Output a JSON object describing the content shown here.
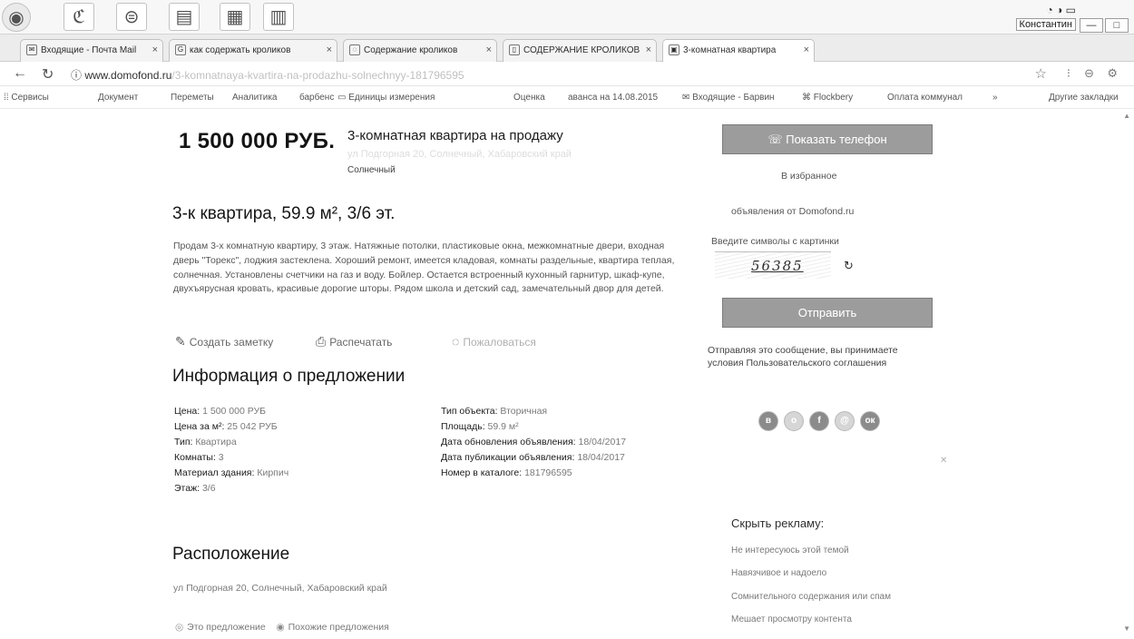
{
  "browser": {
    "tabs": [
      {
        "label": "Входящие - Почта Mail",
        "icon": "mail-icon"
      },
      {
        "label": "как содержать кроликов",
        "icon": "google-icon"
      },
      {
        "label": "Содержание кроликов",
        "icon": "page-icon"
      },
      {
        "label": "СОДЕРЖАНИЕ КРОЛИКОВ",
        "icon": "doc-icon"
      },
      {
        "label": "3-комнатная квартира",
        "icon": "domofond-icon"
      }
    ],
    "url_host": "www.domofond.ru",
    "url_path": "/3-komnatnaya-kvartira-na-prodazhu-solnechnyy-181796595",
    "user_name": "Константин",
    "bookmarks": [
      "Сервисы",
      "Документ",
      "Переметы",
      "Аналитика",
      "барбенс",
      "Единицы измерения",
      "Оценка",
      "аванса на 14.08.2015",
      "Входящие - Барвин",
      "Flockbery",
      "Оплата коммунал",
      "»",
      "Другие закладки"
    ]
  },
  "listing": {
    "price": "1 500 000 РУБ.",
    "title": "3-комнатная квартира на продажу",
    "address_line": "ул Подгорная 20, Солнечный, Хабаровский край",
    "city": "Солнечный",
    "heading": "3-к квартира, 59.9 м², 3/6 эт.",
    "description": "Продам 3-х комнатную квартиру, 3 этаж. Натяжные потолки, пластиковые окна, межкомнатные двери, входная дверь \"Торекс\", лоджия застеклена. Хороший ремонт, имеется кладовая, комнаты раздельные, квартира теплая, солнечная. Установлены счетчики на газ и воду. Бойлер. Остается встроенный кухонный гарнитур, шкаф-купе, двухъярусная кровать, красивые дорогие шторы. Рядом школа и детский сад, замечательный двор для детей.",
    "actions": {
      "note": "Создать заметку",
      "print": "Распечатать",
      "complain": "Пожаловаться"
    }
  },
  "info": {
    "heading": "Информация о предложении",
    "left": [
      {
        "k": "Цена:",
        "v": "1 500 000 РУБ"
      },
      {
        "k": "Цена за м²:",
        "v": "25 042 РУБ"
      },
      {
        "k": "Тип:",
        "v": "Квартира"
      },
      {
        "k": "Комнаты:",
        "v": "3"
      },
      {
        "k": "Материал здания:",
        "v": "Кирпич"
      },
      {
        "k": "Этаж:",
        "v": "3/6"
      }
    ],
    "right": [
      {
        "k": "Тип объекта:",
        "v": "Вторичная"
      },
      {
        "k": "Площадь:",
        "v": "59.9 м²"
      },
      {
        "k": "Дата обновления объявления:",
        "v": "18/04/2017"
      },
      {
        "k": "Дата публикации объявления:",
        "v": "18/04/2017"
      },
      {
        "k": "Номер в каталоге:",
        "v": "181796595"
      }
    ]
  },
  "location": {
    "heading": "Расположение",
    "address": "ул Подгорная 20, Солнечный, Хабаровский край",
    "link_this": "Это предложение",
    "link_similar": "Похожие предложения"
  },
  "sidebar": {
    "show_phone": "Показать телефон",
    "favorite": "В избранное",
    "notify": "объявления от Domofond.ru",
    "captcha_label": "Введите символы с картинки",
    "captcha_text": "56385",
    "send": "Отправить",
    "agree": "Отправляя это сообщение, вы принимаете условия Пользовательского соглашения",
    "social": [
      "vk-icon",
      "ok-icon",
      "facebook-icon",
      "mail-icon",
      "odnoklassniki-icon"
    ],
    "hide_ads_title": "Скрыть рекламу:",
    "hide_reasons": [
      "Не интересуюсь этой темой",
      "Навязчивое и надоело",
      "Сомнительного содержания или спам",
      "Мешает просмотру контента"
    ]
  }
}
